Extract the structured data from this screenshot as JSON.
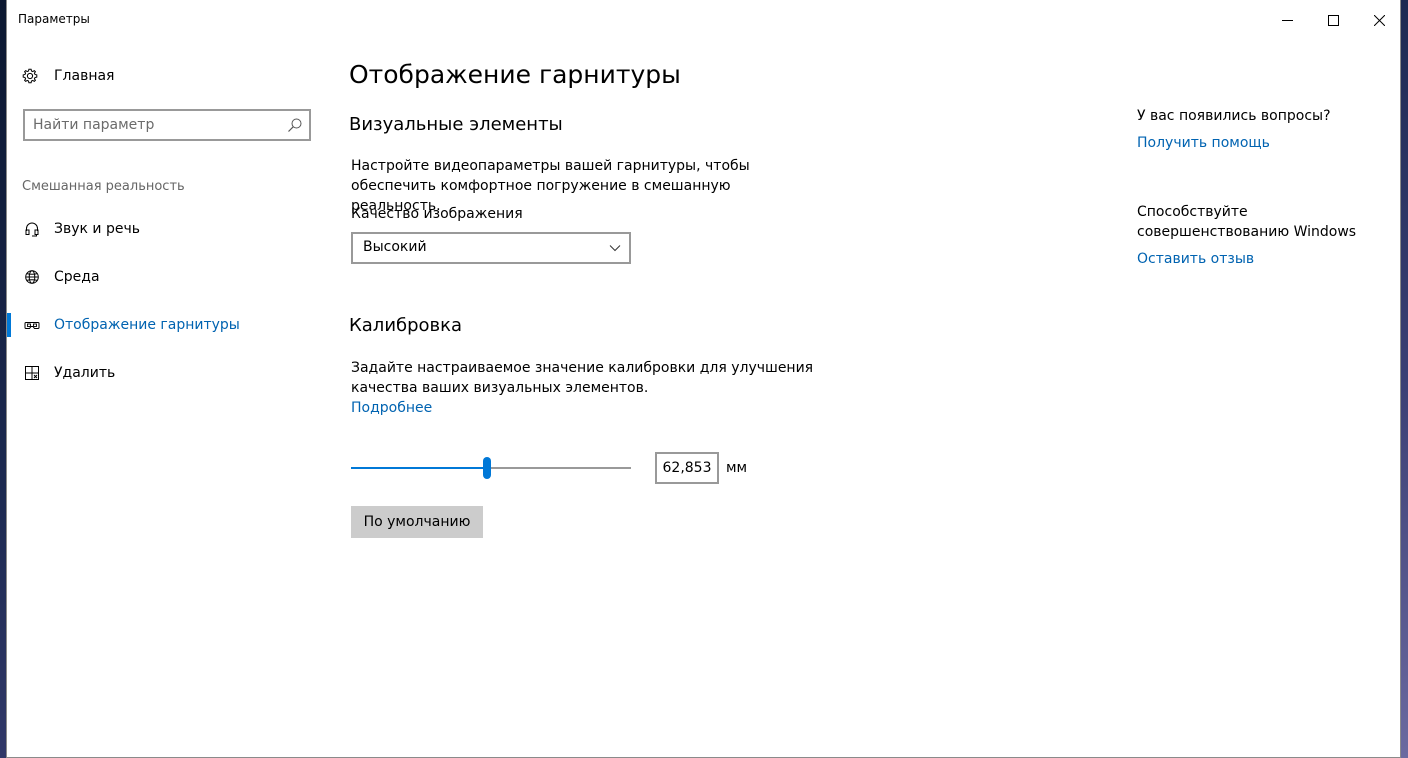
{
  "window": {
    "title": "Параметры"
  },
  "sidebar": {
    "home_label": "Главная",
    "search_placeholder": "Найти параметр",
    "section_title": "Смешанная реальность",
    "items": [
      {
        "label": "Звук и речь",
        "icon": "headset-icon"
      },
      {
        "label": "Среда",
        "icon": "environment-icon"
      },
      {
        "label": "Отображение гарнитуры",
        "icon": "headset-display-icon",
        "active": true
      },
      {
        "label": "Удалить",
        "icon": "uninstall-icon"
      }
    ]
  },
  "main": {
    "page_title": "Отображение гарнитуры",
    "visuals": {
      "heading": "Визуальные элементы",
      "description_line1": "Настройте видеопараметры вашей гарнитуры, чтобы",
      "description_line2": "обеспечить комфортное погружение в смешанную реальность.",
      "quality_label": "Качество изображения",
      "quality_value": "Высокий"
    },
    "calibration": {
      "heading": "Калибровка",
      "description_line1": "Задайте настраиваемое значение калибровки для улучшения",
      "description_line2": "качества ваших визуальных элементов.",
      "more_link": "Подробнее",
      "slider_fraction": 0.485,
      "value": "62,853",
      "unit": "мм",
      "default_button": "По умолчанию"
    }
  },
  "aside": {
    "question": "У вас появились вопросы?",
    "help_link": "Получить помощь",
    "feedback_line1": "Способствуйте",
    "feedback_line2": "совершенствованию Windows",
    "feedback_link": "Оставить отзыв"
  },
  "colors": {
    "accent": "#0078d7",
    "link": "#0063b1"
  }
}
